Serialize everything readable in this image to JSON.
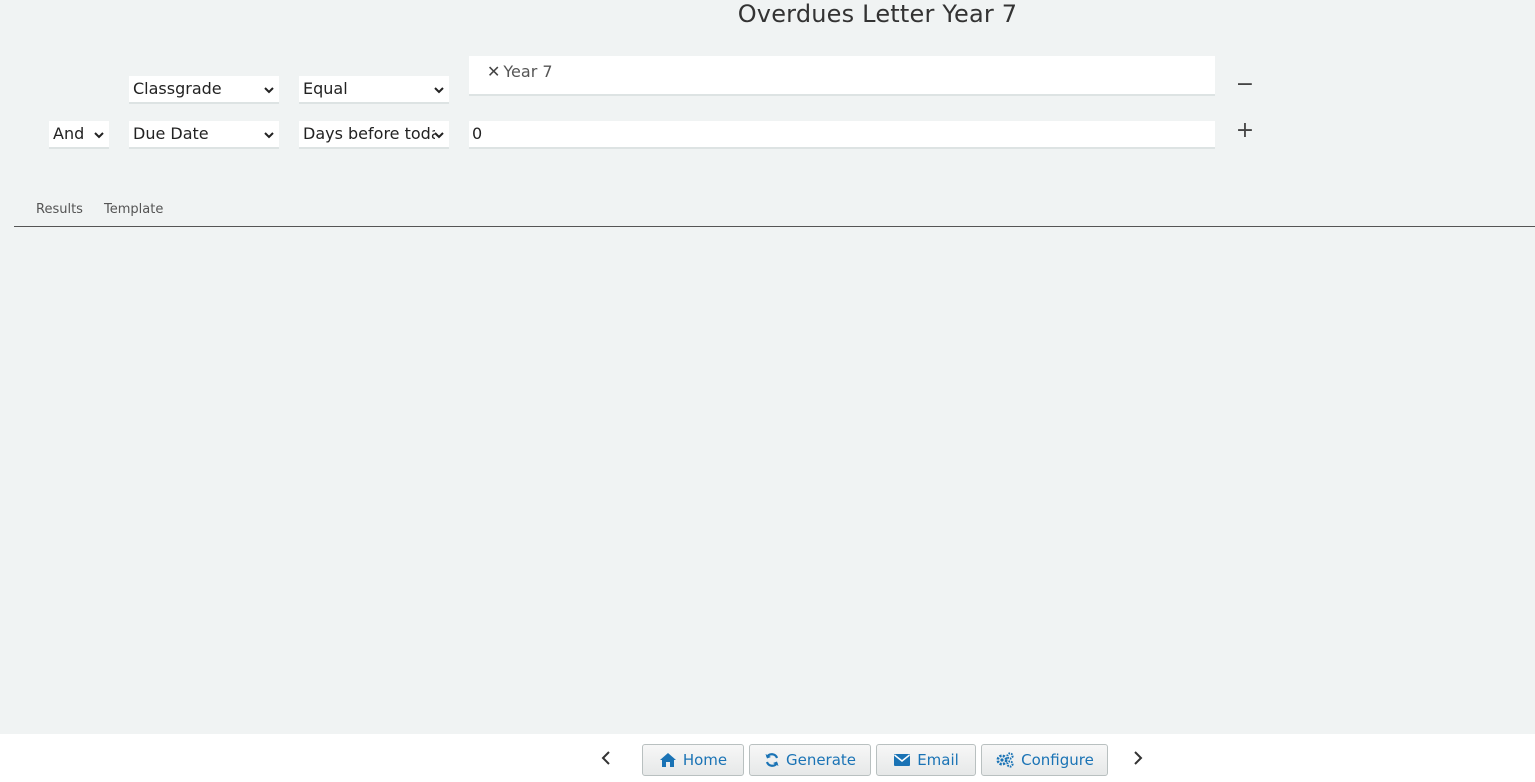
{
  "page": {
    "title": "Overdues Letter Year 7"
  },
  "filters": [
    {
      "connector": "",
      "field": "Classgrade",
      "operator": "Equal",
      "tags": [
        "Year 7"
      ],
      "action_icon": "minus-icon",
      "action_symbol": "−"
    },
    {
      "connector": "And",
      "field": "Due Date",
      "operator": "Days before toda",
      "value": "0",
      "action_icon": "plus-icon",
      "action_symbol": "+"
    }
  ],
  "tabs": [
    {
      "label": "Results"
    },
    {
      "label": "Template"
    }
  ],
  "footer": {
    "home_label": "Home",
    "generate_label": "Generate",
    "email_label": "Email",
    "configure_label": "Configure"
  },
  "colors": {
    "background": "#f0f3f3",
    "accent": "#1a73b5"
  }
}
